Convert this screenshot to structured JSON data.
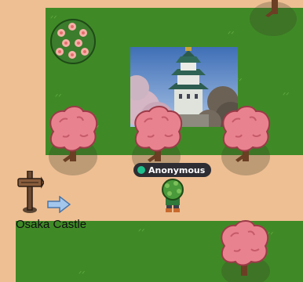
{
  "player": {
    "name": "Anonymous",
    "status_color": "#1fbf8c"
  },
  "location": {
    "label": "Osaka Castle"
  },
  "colors": {
    "path": "#eebf93",
    "grass": "#3f8a26",
    "blossom": "#e9828f",
    "trunk": "#6b3f24"
  },
  "icons": [
    "signpost-icon",
    "right-arrow-icon",
    "status-dot-icon"
  ]
}
